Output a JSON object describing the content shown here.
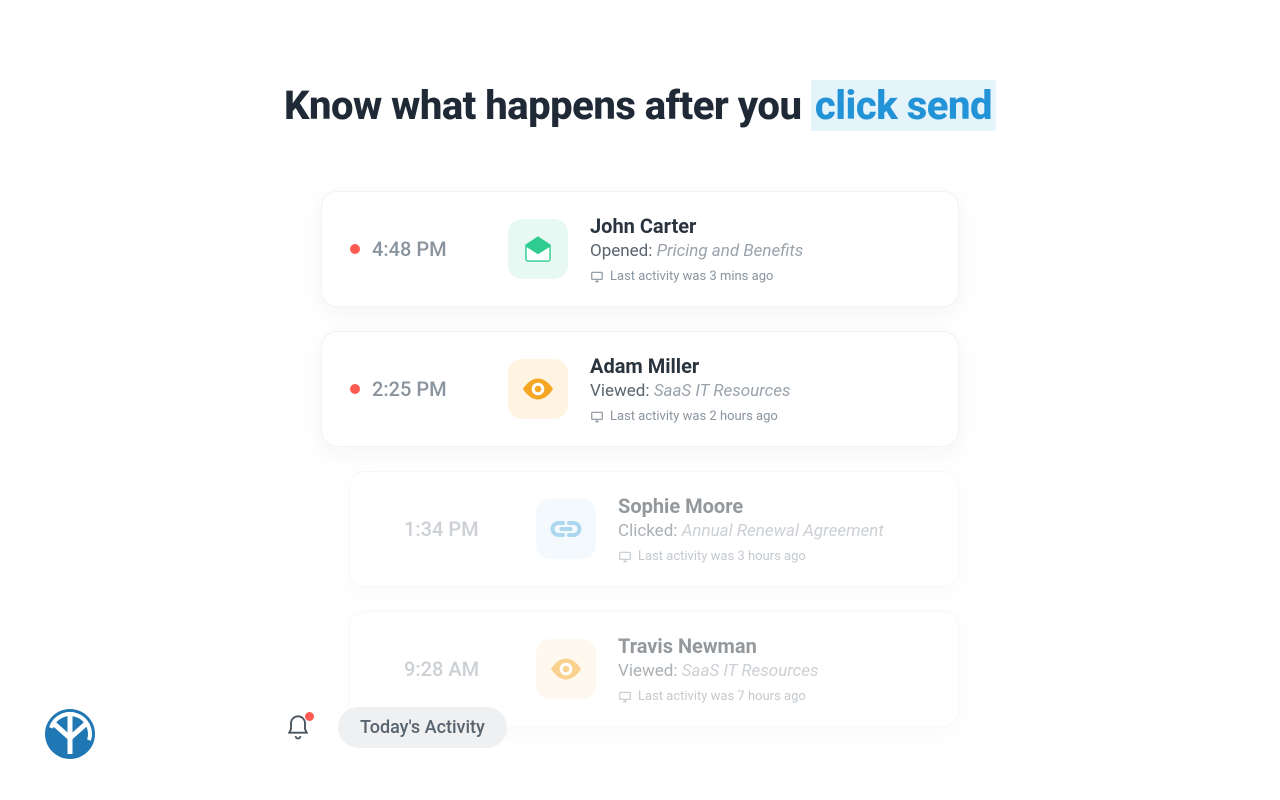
{
  "headline": {
    "prefix": "Know what happens after you ",
    "highlight": "click send"
  },
  "activities": [
    {
      "time": "4:48 PM",
      "unread": true,
      "faded": false,
      "icon": "envelope-open-icon",
      "iconColor": "green",
      "name": "John Carter",
      "actionLabel": "Opened:",
      "actionSubject": "Pricing and Benefits",
      "lastActivity": "Last activity was 3 mins ago"
    },
    {
      "time": "2:25 PM",
      "unread": true,
      "faded": false,
      "icon": "eye-icon",
      "iconColor": "orange",
      "name": "Adam Miller",
      "actionLabel": "Viewed:",
      "actionSubject": "SaaS IT Resources",
      "lastActivity": "Last activity was 2 hours ago"
    },
    {
      "time": "1:34 PM",
      "unread": false,
      "faded": true,
      "icon": "link-icon",
      "iconColor": "blue",
      "name": "Sophie Moore",
      "actionLabel": "Clicked:",
      "actionSubject": "Annual Renewal Agreement",
      "lastActivity": "Last activity was 3 hours ago"
    },
    {
      "time": "9:28 AM",
      "unread": false,
      "faded": true,
      "icon": "eye-icon",
      "iconColor": "orange",
      "name": "Travis Newman",
      "actionLabel": "Viewed:",
      "actionSubject": "SaaS IT Resources",
      "lastActivity": "Last activity was 7 hours ago"
    }
  ],
  "footer": {
    "todayLabel": "Today's Activity"
  }
}
